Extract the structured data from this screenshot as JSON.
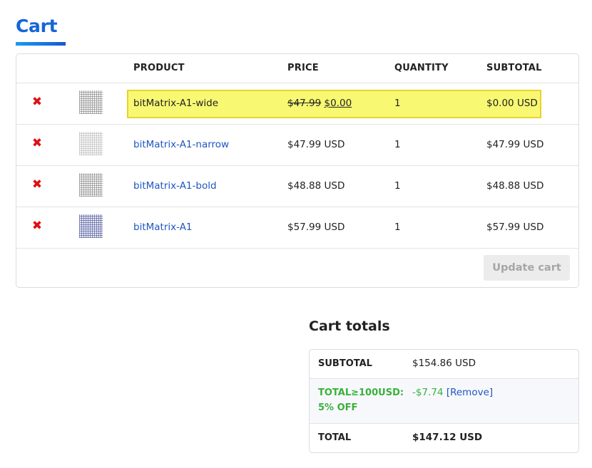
{
  "page": {
    "title": "Cart"
  },
  "table": {
    "headers": {
      "product": "PRODUCT",
      "price": "PRICE",
      "quantity": "QUANTITY",
      "subtotal": "SUBTOTAL"
    },
    "rows": [
      {
        "remove_icon": "✖",
        "product": "bitMatrix-A1-wide",
        "price_old": "$47.99",
        "price_new": "$0.00",
        "quantity": "1",
        "subtotal": "$0.00 USD",
        "highlighted": true
      },
      {
        "remove_icon": "✖",
        "product": "bitMatrix-A1-narrow",
        "price": "$47.99 USD",
        "quantity": "1",
        "subtotal": "$47.99 USD"
      },
      {
        "remove_icon": "✖",
        "product": "bitMatrix-A1-bold",
        "price": "$48.88 USD",
        "quantity": "1",
        "subtotal": "$48.88 USD"
      },
      {
        "remove_icon": "✖",
        "product": "bitMatrix-A1",
        "price": "$57.99 USD",
        "quantity": "1",
        "subtotal": "$57.99 USD"
      }
    ],
    "update_button": "Update cart"
  },
  "totals": {
    "title": "Cart totals",
    "subtotal_label": "SUBTOTAL",
    "subtotal_value": "$154.86 USD",
    "discount_label_line1": "TOTAL≥100USD:",
    "discount_label_line2": "5% OFF",
    "discount_value": "-$7.74",
    "discount_remove": "[Remove]",
    "total_label": "TOTAL",
    "total_value": "$147.12 USD"
  },
  "colors": {
    "accent": "#1466d8",
    "link": "#1f56c0",
    "remove": "#e01010",
    "discount": "#3ab13a",
    "highlight": "#f8f872"
  }
}
